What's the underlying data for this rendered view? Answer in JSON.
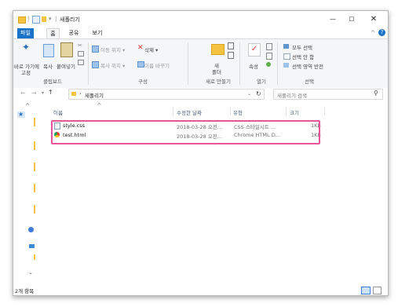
{
  "window": {
    "title": "새폴리기"
  },
  "quick_access_separator": "|",
  "quick_access_dropdown": "▾",
  "window_controls": {
    "minimize": "—",
    "maximize": "☐",
    "close": "✕"
  },
  "tabs": [
    {
      "label": "파일"
    },
    {
      "label": "홈"
    },
    {
      "label": "공유"
    },
    {
      "label": "보기"
    }
  ],
  "ribbon": {
    "clipboard": {
      "pin_label_1": "바로 가기에",
      "pin_label_2": "고정",
      "copy_label": "복사",
      "paste_label": "붙여넣기",
      "group_label": "클립보드"
    },
    "organize": {
      "move_to": "이동 위치 ▾",
      "copy_to": "복사 위치 ▾",
      "delete": "삭제 ▾",
      "rename": "이름 바꾸기",
      "group_label": "구성"
    },
    "new": {
      "new_folder_1": "새",
      "new_folder_2": "폴더",
      "group_label": "새로 만들기"
    },
    "open": {
      "properties": "속성",
      "group_label": "열기"
    },
    "select": {
      "select_all": "모두 선택",
      "select_none": "선택 안 함",
      "invert": "선택 영역 반전",
      "group_label": "선택"
    }
  },
  "nav": {
    "path_chevron": "›",
    "path_folder": "새폴리기",
    "search_placeholder": "새폴리기 검색"
  },
  "columns": {
    "name": "이름",
    "date": "수정한 날짜",
    "type": "유형",
    "size": "크기"
  },
  "files": [
    {
      "name": "style.css",
      "date": "2018-03-28 오전...",
      "type": "CSS 스타일시트 ...",
      "size": "1KB"
    },
    {
      "name": "test.html",
      "date": "2018-03-28 오전...",
      "type": "Chrome HTML D...",
      "size": "1KB"
    }
  ],
  "status": {
    "item_count": "2개 항목"
  },
  "colors": {
    "accent": "#1a73c8",
    "highlight": "#e8559a",
    "folder": "#f5c242"
  }
}
